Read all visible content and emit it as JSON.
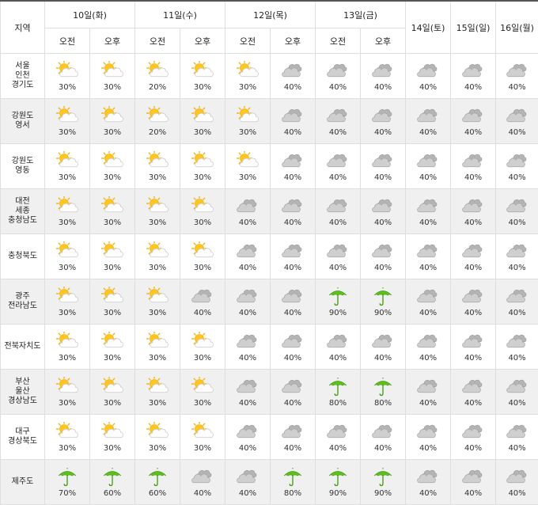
{
  "header": {
    "region_label": "지역",
    "days": [
      {
        "label": "10일(화)",
        "split": true
      },
      {
        "label": "11일(수)",
        "split": true
      },
      {
        "label": "12일(목)",
        "split": true
      },
      {
        "label": "13일(금)",
        "split": true
      },
      {
        "label": "14일(토)",
        "split": false
      },
      {
        "label": "15일(일)",
        "split": false
      },
      {
        "label": "16일(월)",
        "split": false
      }
    ],
    "am_label": "오전",
    "pm_label": "오후"
  },
  "legend": {
    "partly-cloudy": "partly-cloudy-icon",
    "cloudy": "cloudy-icon",
    "rain": "umbrella-icon"
  },
  "rows": [
    {
      "region": [
        "서울",
        "인천",
        "경기도"
      ],
      "cells": [
        {
          "icon": "partly-cloudy",
          "pct": "30%"
        },
        {
          "icon": "partly-cloudy",
          "pct": "30%"
        },
        {
          "icon": "partly-cloudy",
          "pct": "20%"
        },
        {
          "icon": "partly-cloudy",
          "pct": "30%"
        },
        {
          "icon": "partly-cloudy",
          "pct": "30%"
        },
        {
          "icon": "cloudy",
          "pct": "40%"
        },
        {
          "icon": "cloudy",
          "pct": "40%"
        },
        {
          "icon": "cloudy",
          "pct": "40%"
        },
        {
          "icon": "cloudy",
          "pct": "40%"
        },
        {
          "icon": "cloudy",
          "pct": "40%"
        },
        {
          "icon": "cloudy",
          "pct": "40%"
        }
      ]
    },
    {
      "region": [
        "강원도",
        "영서"
      ],
      "cells": [
        {
          "icon": "partly-cloudy",
          "pct": "30%"
        },
        {
          "icon": "partly-cloudy",
          "pct": "30%"
        },
        {
          "icon": "partly-cloudy",
          "pct": "20%"
        },
        {
          "icon": "partly-cloudy",
          "pct": "30%"
        },
        {
          "icon": "partly-cloudy",
          "pct": "30%"
        },
        {
          "icon": "cloudy",
          "pct": "40%"
        },
        {
          "icon": "cloudy",
          "pct": "40%"
        },
        {
          "icon": "cloudy",
          "pct": "40%"
        },
        {
          "icon": "cloudy",
          "pct": "40%"
        },
        {
          "icon": "cloudy",
          "pct": "40%"
        },
        {
          "icon": "cloudy",
          "pct": "40%"
        }
      ]
    },
    {
      "region": [
        "강원도",
        "영동"
      ],
      "cells": [
        {
          "icon": "partly-cloudy",
          "pct": "30%"
        },
        {
          "icon": "partly-cloudy",
          "pct": "30%"
        },
        {
          "icon": "partly-cloudy",
          "pct": "30%"
        },
        {
          "icon": "partly-cloudy",
          "pct": "30%"
        },
        {
          "icon": "partly-cloudy",
          "pct": "30%"
        },
        {
          "icon": "cloudy",
          "pct": "40%"
        },
        {
          "icon": "cloudy",
          "pct": "40%"
        },
        {
          "icon": "cloudy",
          "pct": "40%"
        },
        {
          "icon": "cloudy",
          "pct": "40%"
        },
        {
          "icon": "cloudy",
          "pct": "40%"
        },
        {
          "icon": "cloudy",
          "pct": "40%"
        }
      ]
    },
    {
      "region": [
        "대전",
        "세종",
        "충청남도"
      ],
      "cells": [
        {
          "icon": "partly-cloudy",
          "pct": "30%"
        },
        {
          "icon": "partly-cloudy",
          "pct": "30%"
        },
        {
          "icon": "partly-cloudy",
          "pct": "30%"
        },
        {
          "icon": "partly-cloudy",
          "pct": "30%"
        },
        {
          "icon": "cloudy",
          "pct": "40%"
        },
        {
          "icon": "cloudy",
          "pct": "40%"
        },
        {
          "icon": "cloudy",
          "pct": "40%"
        },
        {
          "icon": "cloudy",
          "pct": "40%"
        },
        {
          "icon": "cloudy",
          "pct": "40%"
        },
        {
          "icon": "cloudy",
          "pct": "40%"
        },
        {
          "icon": "cloudy",
          "pct": "40%"
        }
      ]
    },
    {
      "region": [
        "충청북도"
      ],
      "cells": [
        {
          "icon": "partly-cloudy",
          "pct": "30%"
        },
        {
          "icon": "partly-cloudy",
          "pct": "30%"
        },
        {
          "icon": "partly-cloudy",
          "pct": "30%"
        },
        {
          "icon": "partly-cloudy",
          "pct": "30%"
        },
        {
          "icon": "cloudy",
          "pct": "40%"
        },
        {
          "icon": "cloudy",
          "pct": "40%"
        },
        {
          "icon": "cloudy",
          "pct": "40%"
        },
        {
          "icon": "cloudy",
          "pct": "40%"
        },
        {
          "icon": "cloudy",
          "pct": "40%"
        },
        {
          "icon": "cloudy",
          "pct": "40%"
        },
        {
          "icon": "cloudy",
          "pct": "40%"
        }
      ]
    },
    {
      "region": [
        "광주",
        "전라남도"
      ],
      "cells": [
        {
          "icon": "partly-cloudy",
          "pct": "30%"
        },
        {
          "icon": "partly-cloudy",
          "pct": "30%"
        },
        {
          "icon": "partly-cloudy",
          "pct": "30%"
        },
        {
          "icon": "cloudy",
          "pct": "40%"
        },
        {
          "icon": "cloudy",
          "pct": "40%"
        },
        {
          "icon": "cloudy",
          "pct": "40%"
        },
        {
          "icon": "rain",
          "pct": "90%"
        },
        {
          "icon": "rain",
          "pct": "90%"
        },
        {
          "icon": "cloudy",
          "pct": "40%"
        },
        {
          "icon": "cloudy",
          "pct": "40%"
        },
        {
          "icon": "cloudy",
          "pct": "40%"
        }
      ]
    },
    {
      "region": [
        "전북자치도"
      ],
      "cells": [
        {
          "icon": "partly-cloudy",
          "pct": "30%"
        },
        {
          "icon": "partly-cloudy",
          "pct": "30%"
        },
        {
          "icon": "partly-cloudy",
          "pct": "30%"
        },
        {
          "icon": "partly-cloudy",
          "pct": "30%"
        },
        {
          "icon": "cloudy",
          "pct": "40%"
        },
        {
          "icon": "cloudy",
          "pct": "40%"
        },
        {
          "icon": "cloudy",
          "pct": "40%"
        },
        {
          "icon": "cloudy",
          "pct": "40%"
        },
        {
          "icon": "cloudy",
          "pct": "40%"
        },
        {
          "icon": "cloudy",
          "pct": "40%"
        },
        {
          "icon": "cloudy",
          "pct": "40%"
        }
      ]
    },
    {
      "region": [
        "부산",
        "울산",
        "경상남도"
      ],
      "cells": [
        {
          "icon": "partly-cloudy",
          "pct": "30%"
        },
        {
          "icon": "partly-cloudy",
          "pct": "30%"
        },
        {
          "icon": "partly-cloudy",
          "pct": "30%"
        },
        {
          "icon": "partly-cloudy",
          "pct": "30%"
        },
        {
          "icon": "cloudy",
          "pct": "40%"
        },
        {
          "icon": "cloudy",
          "pct": "40%"
        },
        {
          "icon": "rain",
          "pct": "80%"
        },
        {
          "icon": "rain",
          "pct": "80%"
        },
        {
          "icon": "cloudy",
          "pct": "40%"
        },
        {
          "icon": "cloudy",
          "pct": "40%"
        },
        {
          "icon": "cloudy",
          "pct": "40%"
        }
      ]
    },
    {
      "region": [
        "대구",
        "경상북도"
      ],
      "cells": [
        {
          "icon": "partly-cloudy",
          "pct": "30%"
        },
        {
          "icon": "partly-cloudy",
          "pct": "30%"
        },
        {
          "icon": "partly-cloudy",
          "pct": "30%"
        },
        {
          "icon": "partly-cloudy",
          "pct": "30%"
        },
        {
          "icon": "cloudy",
          "pct": "40%"
        },
        {
          "icon": "cloudy",
          "pct": "40%"
        },
        {
          "icon": "cloudy",
          "pct": "40%"
        },
        {
          "icon": "cloudy",
          "pct": "40%"
        },
        {
          "icon": "cloudy",
          "pct": "40%"
        },
        {
          "icon": "cloudy",
          "pct": "40%"
        },
        {
          "icon": "cloudy",
          "pct": "40%"
        }
      ]
    },
    {
      "region": [
        "제주도"
      ],
      "cells": [
        {
          "icon": "rain",
          "pct": "70%"
        },
        {
          "icon": "rain",
          "pct": "60%"
        },
        {
          "icon": "rain",
          "pct": "60%"
        },
        {
          "icon": "cloudy",
          "pct": "40%"
        },
        {
          "icon": "cloudy",
          "pct": "40%"
        },
        {
          "icon": "rain",
          "pct": "80%"
        },
        {
          "icon": "rain",
          "pct": "90%"
        },
        {
          "icon": "rain",
          "pct": "90%"
        },
        {
          "icon": "cloudy",
          "pct": "40%"
        },
        {
          "icon": "cloudy",
          "pct": "40%"
        },
        {
          "icon": "cloudy",
          "pct": "40%"
        }
      ]
    }
  ]
}
